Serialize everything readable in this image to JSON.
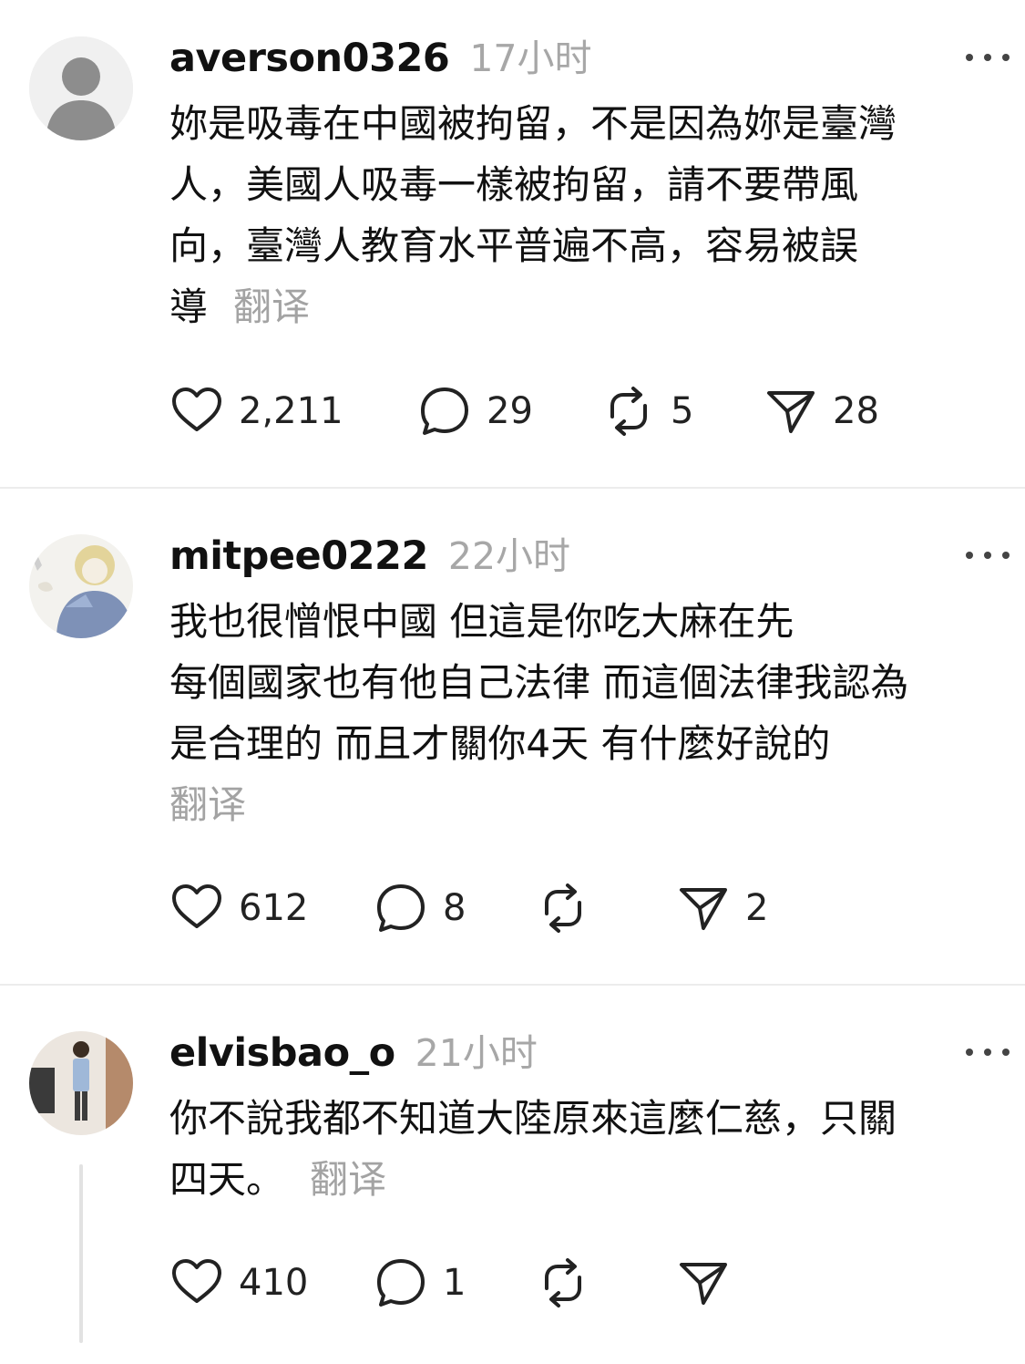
{
  "posts": [
    {
      "username": "averson0326",
      "time": "17小时",
      "lines": [
        "妳是吸毒在中國被拘留，不是因為妳是臺灣",
        "人，美國人吸毒一樣被拘留，請不要帶風",
        "向，臺灣人教育水平普遍不高，容易被誤",
        "導"
      ],
      "translate_label": "翻译",
      "likes": "2,211",
      "replies": "29",
      "reposts": "5",
      "shares": "28",
      "avatar": "default-user-avatar"
    },
    {
      "username": "mitpee0222",
      "time": "22小时",
      "lines": [
        "我也很憎恨中國 但這是你吃大麻在先",
        "每個國家也有他自己法律 而這個法律我認為",
        "是合理的 而且才關你4天 有什麼好說的"
      ],
      "translate_label": "翻译",
      "likes": "612",
      "replies": "8",
      "reposts": "",
      "shares": "2",
      "avatar": "photo-avatar"
    },
    {
      "username": "elvisbao_o",
      "time": "21小时",
      "lines": [
        "你不說我都不知道大陸原來這麼仁慈，只關",
        "四天。"
      ],
      "translate_label": "翻译",
      "likes": "410",
      "replies": "1",
      "reposts": "",
      "shares": "",
      "avatar": "photo-avatar"
    }
  ],
  "icons": {
    "like": "heart-icon",
    "reply": "comment-icon",
    "repost": "repost-icon",
    "share": "send-icon",
    "more": "more-icon"
  },
  "colors": {
    "text": "#111111",
    "muted": "#a7a7a7",
    "divider": "#ececec"
  }
}
